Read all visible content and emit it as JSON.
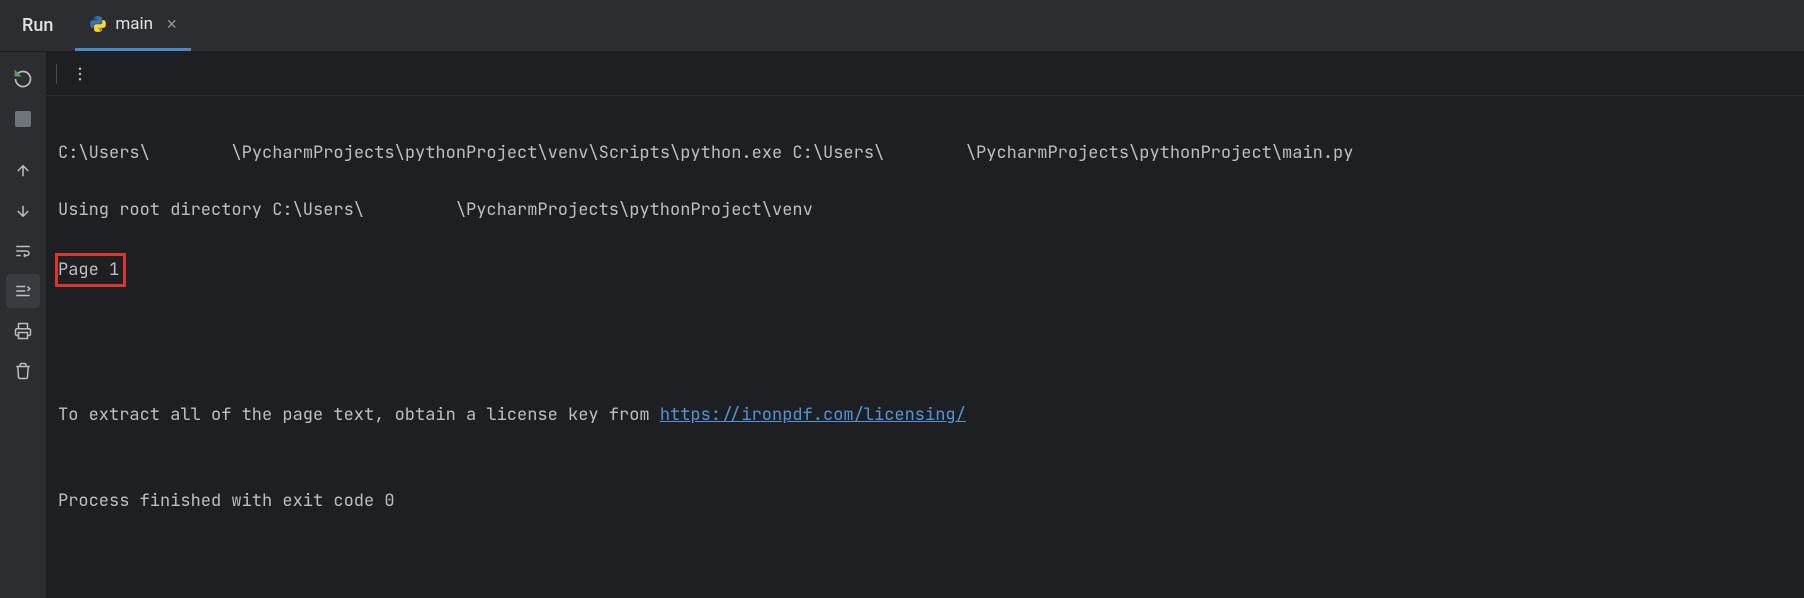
{
  "header": {
    "run_label": "Run",
    "tab": {
      "label": "main",
      "icon": "python"
    }
  },
  "console": {
    "line1_part1": "C:\\Users\\",
    "line1_part2": "\\PycharmProjects\\pythonProject\\venv\\Scripts\\python.exe C:\\Users\\",
    "line1_part3": "\\PycharmProjects\\pythonProject\\main.py ",
    "line2_part1": "Using root directory C:\\Users\\",
    "line2_part2": "\\PycharmProjects\\pythonProject\\venv",
    "line3_highlighted": "Page 1",
    "line4": "",
    "line5": "",
    "line6": "",
    "line7_text": "To extract all of the page text, obtain a license key from ",
    "line7_link": "https://ironpdf.com/licensing/",
    "line8": "",
    "line9": "Process finished with exit code 0"
  },
  "spacing": {
    "gap1": "        ",
    "gap2": "        ",
    "gap3": "         "
  }
}
